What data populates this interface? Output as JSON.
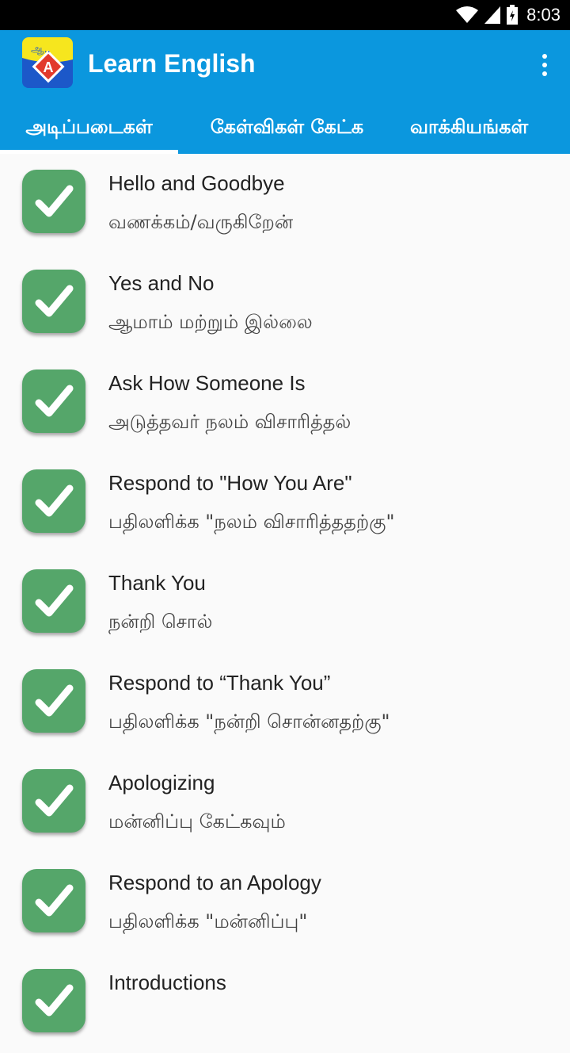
{
  "status_bar": {
    "time": "8:03",
    "icons": [
      "wifi-icon",
      "signal-icon",
      "battery-icon"
    ]
  },
  "app_bar": {
    "title": "Learn English",
    "logo_text": "ஆ..",
    "logo_letter": "A",
    "menu_icon": "overflow-menu-icon"
  },
  "tabs": [
    {
      "label": "அடிப்படைகள்",
      "selected": true
    },
    {
      "label": "கேள்விகள் கேட்க",
      "selected": false
    },
    {
      "label": "வாக்கியங்கள்",
      "selected": false
    }
  ],
  "lessons": [
    {
      "title": "Hello and Goodbye",
      "subtitle": "வணக்கம்/வருகிறேன்",
      "icon": "check-icon"
    },
    {
      "title": "Yes and No",
      "subtitle": "ஆமாம் மற்றும் இல்லை",
      "icon": "check-icon"
    },
    {
      "title": "Ask How Someone Is",
      "subtitle": "அடுத்தவர் நலம் விசாரித்தல்",
      "icon": "check-icon"
    },
    {
      "title": "Respond to \"How You Are\"",
      "subtitle": "பதிலளிக்க \"நலம் விசாரித்ததற்கு\"",
      "icon": "check-icon"
    },
    {
      "title": "Thank You",
      "subtitle": "நன்றி சொல்",
      "icon": "check-icon"
    },
    {
      "title": "Respond to “Thank You”",
      "subtitle": "பதிலளிக்க \"நன்றி சொன்னதற்கு\"",
      "icon": "check-icon"
    },
    {
      "title": "Apologizing",
      "subtitle": "மன்னிப்பு கேட்கவும்",
      "icon": "check-icon"
    },
    {
      "title": "Respond to an Apology",
      "subtitle": "பதிலளிக்க \"மன்னிப்பு\"",
      "icon": "check-icon"
    },
    {
      "title": "Introductions",
      "subtitle": "",
      "icon": "check-icon"
    }
  ],
  "colors": {
    "app_bar": "#0b97de",
    "check_badge": "#55a66a",
    "background": "#fafafa"
  }
}
